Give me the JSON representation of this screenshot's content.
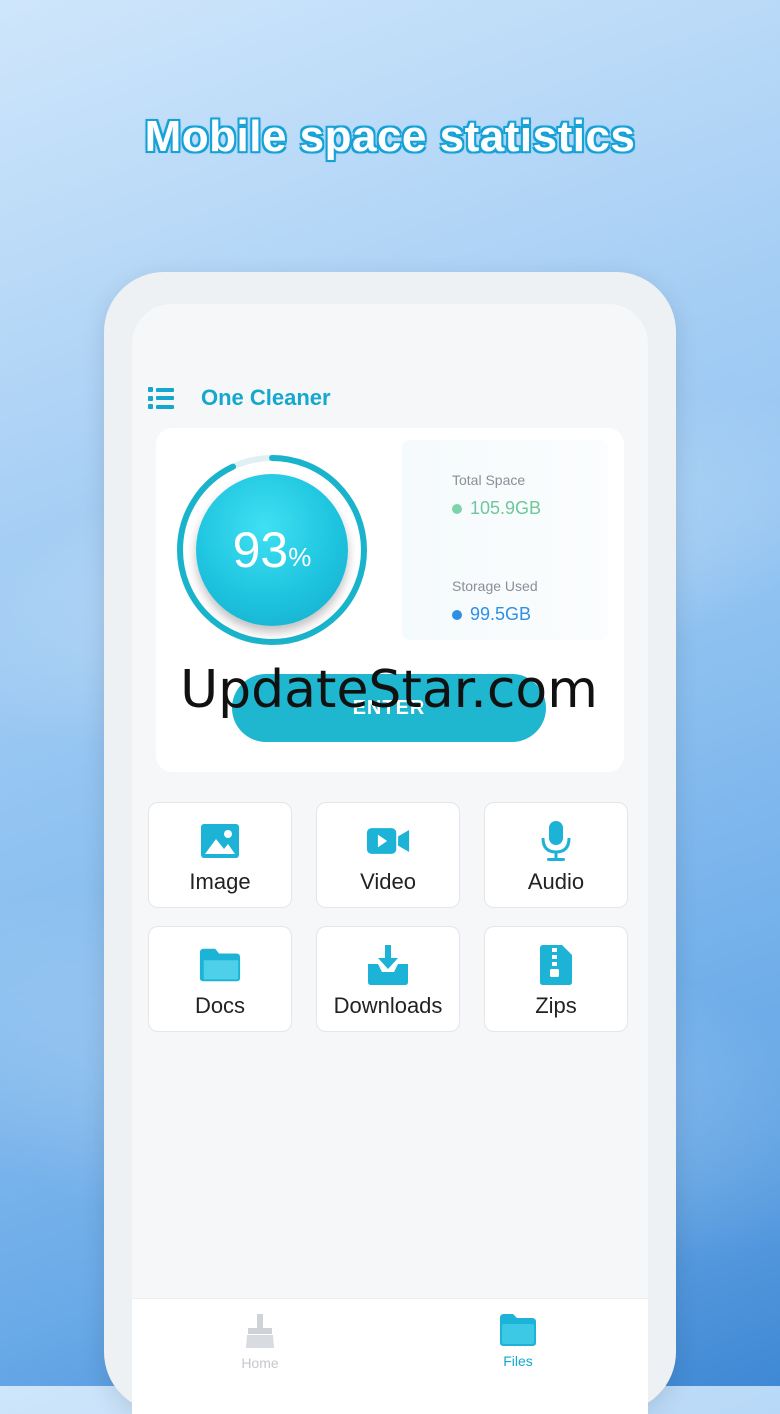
{
  "headline": "Mobile space statistics",
  "app": {
    "title": "One Cleaner"
  },
  "storage": {
    "percent_number": "93",
    "percent_sign": "%",
    "percent_value": 0.93,
    "total_label": "Total Space",
    "total_value": "105.9GB",
    "used_label": "Storage Used",
    "used_value": "99.5GB",
    "enter_label": "ENTER"
  },
  "watermark": "UpdateStar.com",
  "categories": [
    {
      "label": "Image",
      "icon": "image-icon"
    },
    {
      "label": "Video",
      "icon": "video-camera-icon"
    },
    {
      "label": "Audio",
      "icon": "microphone-icon"
    },
    {
      "label": "Docs",
      "icon": "folder-icon"
    },
    {
      "label": "Downloads",
      "icon": "download-tray-icon"
    },
    {
      "label": "Zips",
      "icon": "zip-file-icon"
    }
  ],
  "nav": {
    "home_label": "Home",
    "files_label": "Files"
  },
  "colors": {
    "accent": "#16a7cf",
    "total_dot": "#7fd3a8",
    "used_dot": "#2f8fe6",
    "nav_inactive": "#c7cacf"
  }
}
